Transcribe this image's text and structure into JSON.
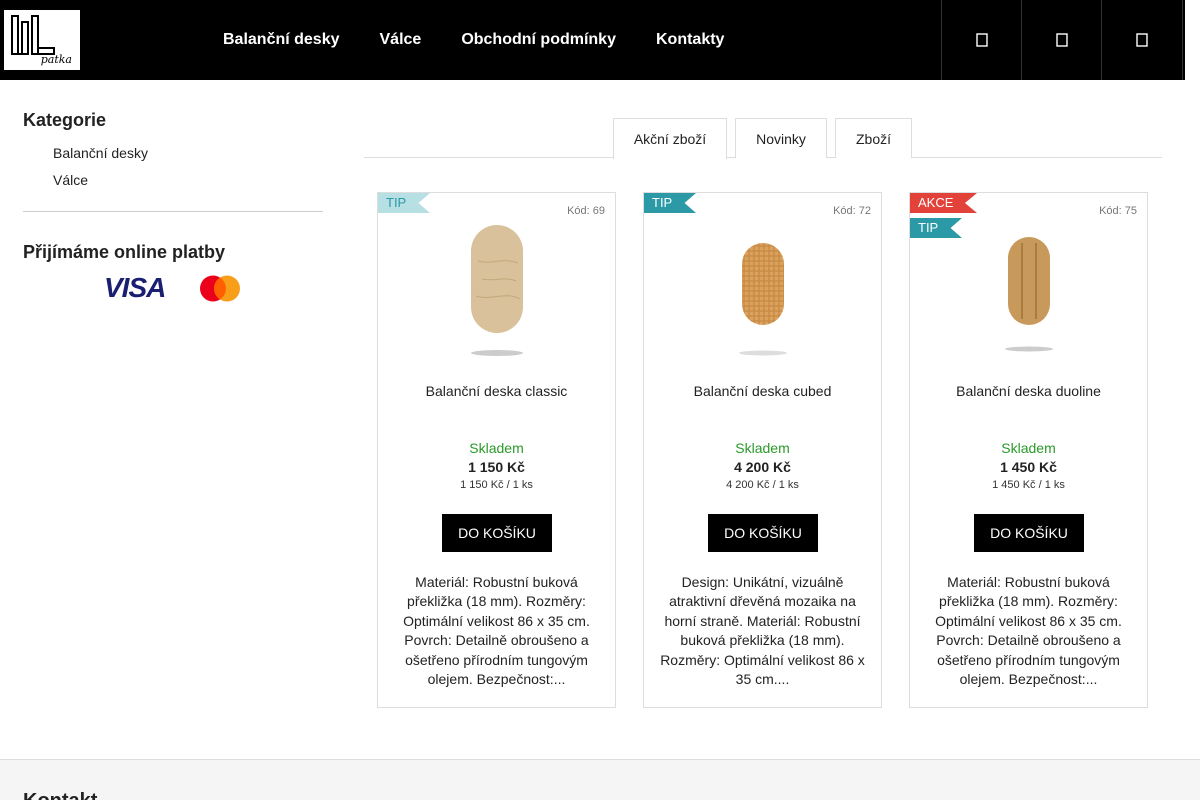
{
  "header": {
    "logo_text": "patka",
    "nav": [
      "Balanční desky",
      "Válce",
      "Obchodní podmínky",
      "Kontakty"
    ],
    "icons": [
      "search-icon",
      "user-icon",
      "cart-icon"
    ]
  },
  "sidebar": {
    "categories_title": "Kategorie",
    "categories": [
      "Balanční desky",
      "Válce"
    ],
    "payments_title": "Přijímáme online platby",
    "visa_text": "VISA"
  },
  "tabs": [
    {
      "label": "Akční zboží",
      "active": true
    },
    {
      "label": "Novinky",
      "active": false
    },
    {
      "label": "Zboží",
      "active": false
    }
  ],
  "products": [
    {
      "badges": [
        "TIP"
      ],
      "code": "Kód: 69",
      "name": "Balanční deska classic",
      "stock": "Skladem",
      "price": "1 150 Kč",
      "unit_price": "1 150 Kč / 1 ks",
      "button": "DO KOŠÍKU",
      "description": "Materiál: Robustní buková překližka (18 mm). Rozměry: Optimální velikost 86 x 35 cm. Povrch: Detailně obroušeno a ošetřeno přírodním tungovým olejem. Bezpečnost:..."
    },
    {
      "badges": [
        "TIP"
      ],
      "code": "Kód: 72",
      "name": "Balanční deska cubed",
      "stock": "Skladem",
      "price": "4 200 Kč",
      "unit_price": "4 200 Kč / 1 ks",
      "button": "DO KOŠÍKU",
      "description": "Design: Unikátní, vizuálně atraktivní dřevěná mozaika na horní straně. Materiál: Robustní buková překližka (18 mm). Rozměry: Optimální velikost 86 x 35 cm...."
    },
    {
      "badges": [
        "AKCE",
        "TIP"
      ],
      "code": "Kód: 75",
      "name": "Balanční deska duoline",
      "stock": "Skladem",
      "price": "1 450 Kč",
      "unit_price": "1 450 Kč / 1 ks",
      "button": "DO KOŠÍKU",
      "description": "Materiál: Robustní buková překližka (18 mm). Rozměry: Optimální velikost 86 x 35 cm. Povrch: Detailně obroušeno a ošetřeno přírodním tungovým olejem. Bezpečnost:..."
    }
  ],
  "footer": {
    "title": "Kontakt"
  },
  "colors": {
    "header_bg": "#000000",
    "tip_badge": "#2b9aa6",
    "akce_badge": "#e2423a",
    "stock_green": "#2a9a2a",
    "visa_blue": "#1a1f71"
  }
}
